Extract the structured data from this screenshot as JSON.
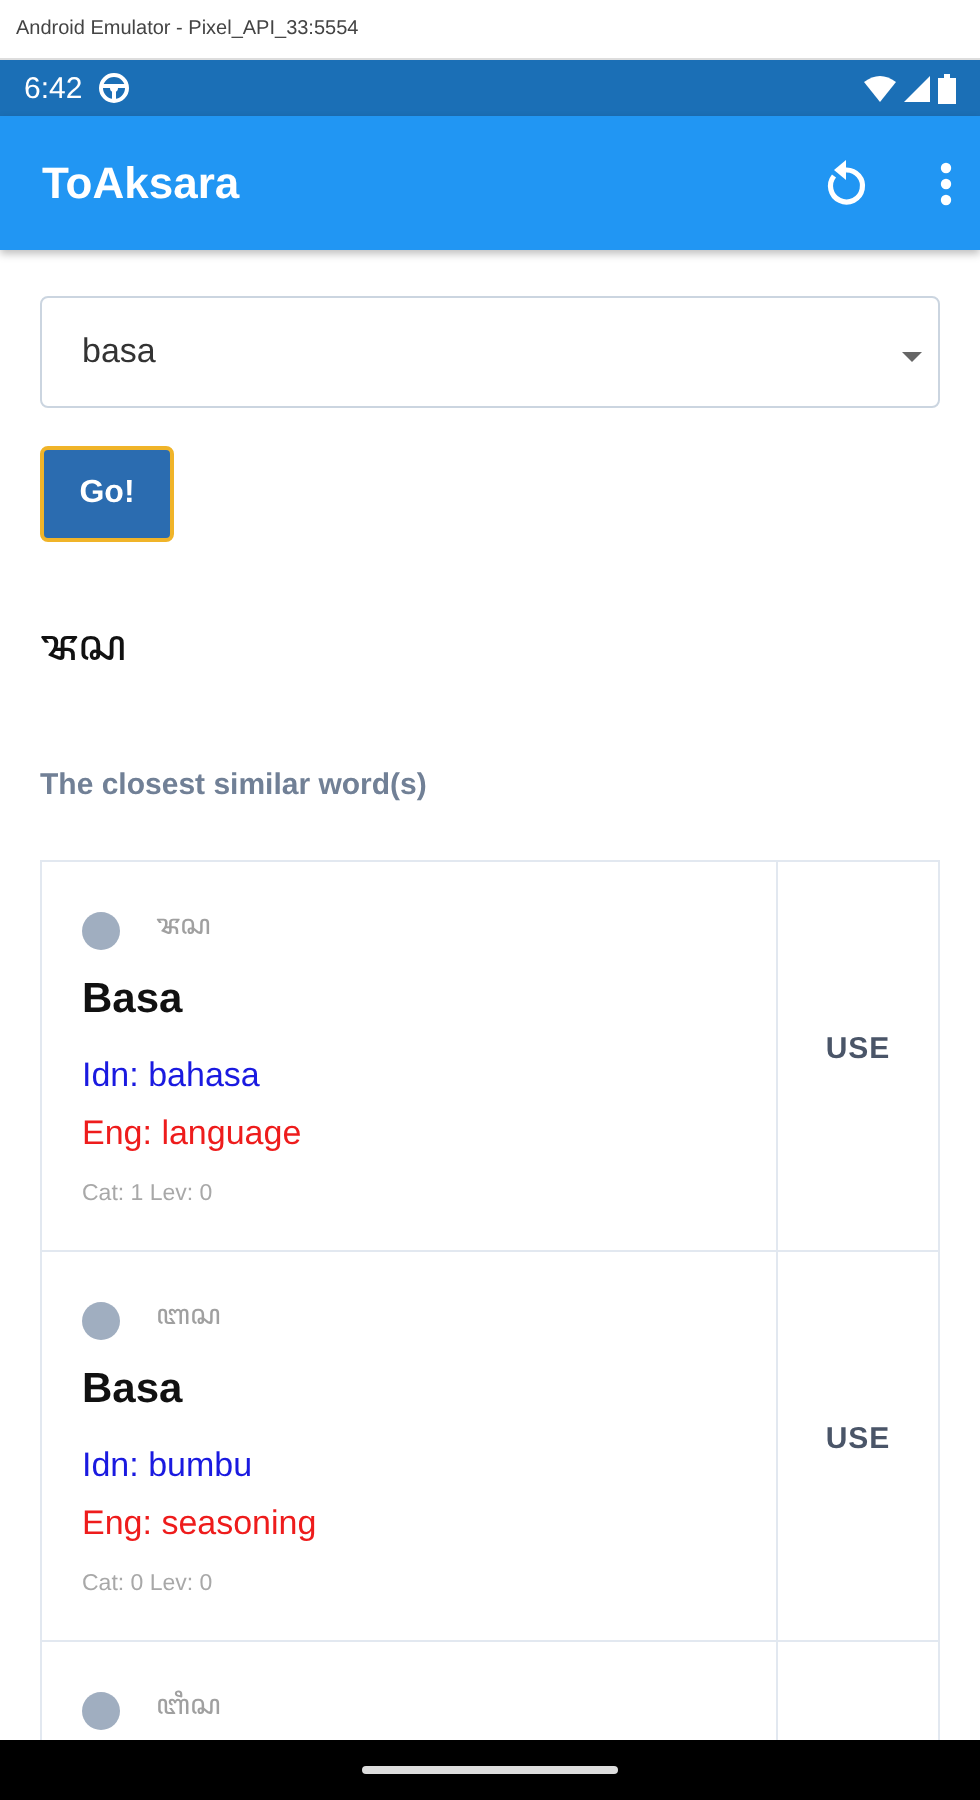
{
  "emulator": {
    "title": "Android Emulator - Pixel_API_33:5554"
  },
  "status_bar": {
    "time": "6:42"
  },
  "app_bar": {
    "title": "ToAksara"
  },
  "input": {
    "value": "basa"
  },
  "go_button": {
    "label": "Go!"
  },
  "result": "ꦨꦱ",
  "subtitle": "The closest similar word(s)",
  "words": [
    {
      "script": "ꦨꦱ",
      "word": "Basa",
      "idn": "Idn: bahasa",
      "eng": "Eng: language",
      "meta": "Cat: 1 Lev: 0",
      "action": "USE",
      "color": "#a0aec0"
    },
    {
      "script": "ꦧꦱ",
      "word": "Basa",
      "idn": "Idn: bumbu",
      "eng": "Eng: seasoning",
      "meta": "Cat: 0 Lev: 0",
      "action": "USE",
      "color": "#a0aec0"
    },
    {
      "script": "ꦧꦶꦱ",
      "color": "#a0aec0"
    }
  ]
}
